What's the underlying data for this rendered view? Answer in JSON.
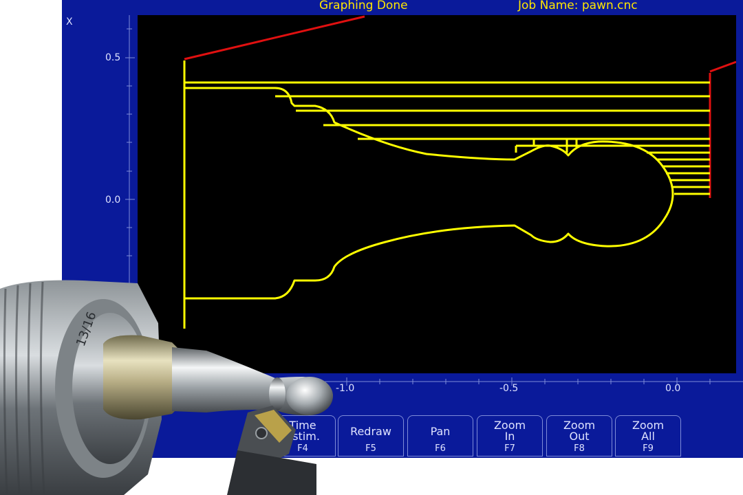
{
  "window": {
    "status": "Graphing Done",
    "job_name": "Job Name: pawn.cnc"
  },
  "graph": {
    "axis_label_x": "X",
    "y_ticks": [
      "0.5",
      "0.0"
    ],
    "x_ticks": [
      "-1.0",
      "-0.5",
      "0.0"
    ],
    "colors": {
      "background": "#000000",
      "toolpath": "#ffff00",
      "rapid": "#e01010",
      "panel": "#0a1a9a"
    }
  },
  "function_keys": [
    {
      "label": "Time Estim.",
      "key": "F4"
    },
    {
      "label": "Redraw",
      "key": "F5"
    },
    {
      "label": "Pan",
      "key": "F6"
    },
    {
      "label": "Zoom In",
      "key": "F7"
    },
    {
      "label": "Zoom Out",
      "key": "F8"
    },
    {
      "label": "Zoom All",
      "key": "F9"
    }
  ],
  "photo": {
    "stamp": "13/16",
    "description_icon": "turned-pawn-part-photo"
  }
}
